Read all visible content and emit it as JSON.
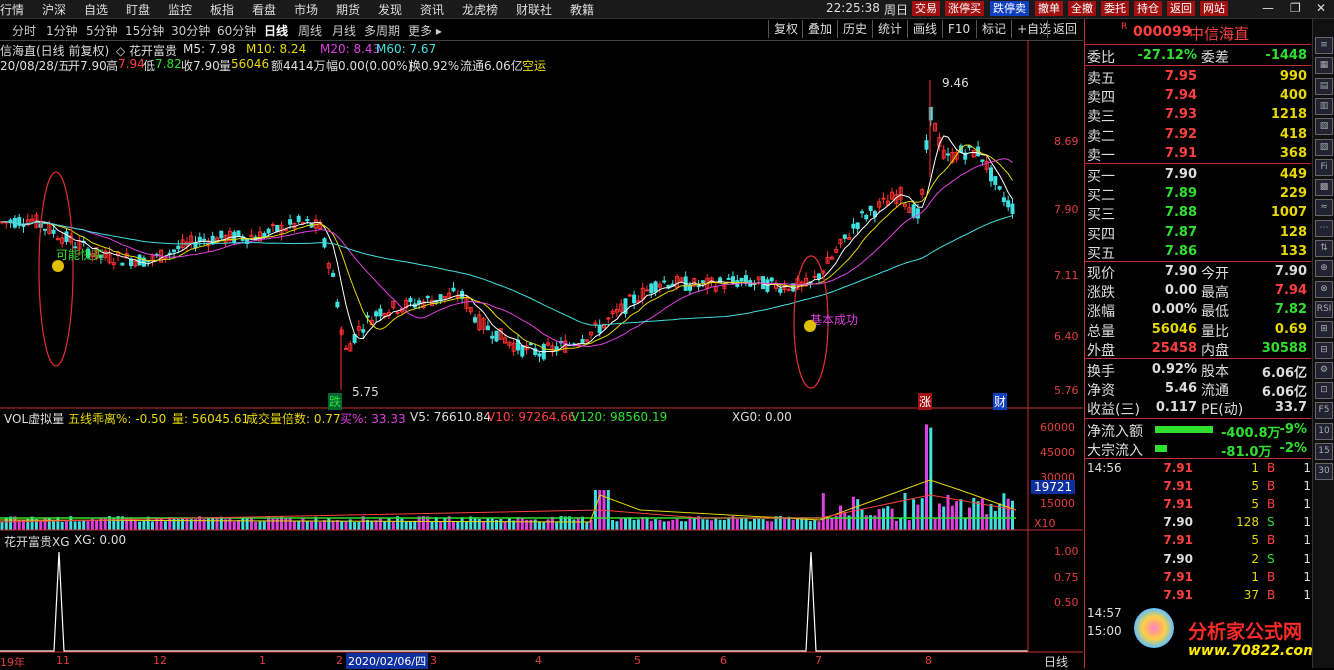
{
  "menu": [
    "行情",
    "沪深",
    "自选",
    "盯盘",
    "监控",
    "板指",
    "看盘",
    "市场",
    "期货",
    "发现",
    "资讯",
    "龙虎榜",
    "财联社",
    "教籍"
  ],
  "clock": "22:25:38",
  "weekday": "周日",
  "menu_buttons": [
    "交易",
    "涨停买",
    "跌停卖",
    "撤单",
    "全撤",
    "委托",
    "持仓",
    "返回",
    "网站"
  ],
  "periods": [
    "分时",
    "1分钟",
    "5分钟",
    "15分钟",
    "30分钟",
    "60分钟",
    "日线",
    "周线",
    "月线",
    "多周期",
    "更多 ▸"
  ],
  "selected_period": "日线",
  "tools": [
    "复权",
    "叠加",
    "历史",
    "统计",
    "画线",
    "F10",
    "标记",
    "+自选",
    "返回"
  ],
  "chart_header": {
    "name": "信海直(日线 前复权)",
    "indicator": "◇ 花开富贵",
    "m5": "M5: 7.98",
    "m10": "M10: 8.24",
    "m20": "M20: 8.43",
    "m60": "M60: 7.67",
    "date": "20/08/28/五",
    "open": "开7.90",
    "high_lbl": "高",
    "high": "7.94",
    "low_lbl": "低",
    "low": "7.82",
    "close": "收7.90",
    "vol_lbl": "量",
    "vol": "56046",
    "amount": "额4414万",
    "amp": "幅0.00(0.00%)",
    "turn": "换0.92%",
    "float": "流通6.06亿",
    "status": "空运"
  },
  "price_axis": [
    "8.69",
    "7.90",
    "7.11",
    "6.40",
    "5.76"
  ],
  "chart_annotations": {
    "high": "9.46",
    "low": "5.75",
    "buy_label": "可能快买",
    "success_label": "基本成功",
    "die": "跌",
    "zhang": "涨",
    "cai": "财"
  },
  "vol_header": {
    "title": "VOL虚拟量",
    "dev": "五线乖离%: -0.50",
    "vol": "量: 56045.61",
    "times": "成交量倍数: 0.77",
    "buy": "买%: 33.33",
    "v5": "V5: 76610.84",
    "v10": "V10: 97264.66",
    "v120": "V120: 98560.19",
    "xg0": "XG0: 0.00"
  },
  "vol_axis": [
    "60000",
    "45000",
    "30000",
    "15000"
  ],
  "vol_marker": "19721",
  "vol_unit": "X10",
  "ind_header": {
    "title": "花开富贵XG",
    "xg": "XG: 0.00"
  },
  "ind_axis": [
    "1.00",
    "0.75",
    "0.50"
  ],
  "date_axis": [
    "19年",
    "11",
    "12",
    "1",
    "2",
    "2020/02/06/四",
    "3",
    "4",
    "5",
    "6",
    "7",
    "8"
  ],
  "date_axis_right": "日线",
  "right_panel": {
    "code": "000099",
    "name": "中信海直",
    "weibi_lbl": "委比",
    "weibi": "-27.12%",
    "weicha_lbl": "委差",
    "weicha": "-1448",
    "asks": [
      {
        "label": "卖五",
        "price": "7.95",
        "vol": "990"
      },
      {
        "label": "卖四",
        "price": "7.94",
        "vol": "400"
      },
      {
        "label": "卖三",
        "price": "7.93",
        "vol": "1218"
      },
      {
        "label": "卖二",
        "price": "7.92",
        "vol": "418"
      },
      {
        "label": "卖一",
        "price": "7.91",
        "vol": "368"
      }
    ],
    "bids": [
      {
        "label": "买一",
        "price": "7.90",
        "vol": "449"
      },
      {
        "label": "买二",
        "price": "7.89",
        "vol": "229"
      },
      {
        "label": "买三",
        "price": "7.88",
        "vol": "1007"
      },
      {
        "label": "买四",
        "price": "7.87",
        "vol": "128"
      },
      {
        "label": "买五",
        "price": "7.86",
        "vol": "133"
      }
    ],
    "stats": [
      {
        "l1": "现价",
        "v1": "7.90",
        "l2": "今开",
        "v2": "7.90",
        "c1": "white",
        "c2": "white"
      },
      {
        "l1": "涨跌",
        "v1": "0.00",
        "l2": "最高",
        "v2": "7.94",
        "c1": "white",
        "c2": "red"
      },
      {
        "l1": "涨幅",
        "v1": "0.00%",
        "l2": "最低",
        "v2": "7.82",
        "c1": "white",
        "c2": "green"
      },
      {
        "l1": "总量",
        "v1": "56046",
        "l2": "量比",
        "v2": "0.69",
        "c1": "yellow",
        "c2": "yellow"
      },
      {
        "l1": "外盘",
        "v1": "25458",
        "l2": "内盘",
        "v2": "30588",
        "c1": "red",
        "c2": "green"
      }
    ],
    "stats2": [
      {
        "l1": "换手",
        "v1": "0.92%",
        "l2": "股本",
        "v2": "6.06亿"
      },
      {
        "l1": "净资",
        "v1": "5.46",
        "l2": "流通",
        "v2": "6.06亿"
      },
      {
        "l1": "收益(三)",
        "v1": "0.117",
        "l2": "PE(动)",
        "v2": "33.7"
      }
    ],
    "flow": [
      {
        "label": "净流入额",
        "val": "-400.8万",
        "pct": "-9%"
      },
      {
        "label": "大宗流入",
        "val": "-81.0万",
        "pct": "-2%"
      }
    ],
    "ticks": [
      {
        "time": "14:56",
        "price": "7.91",
        "vol": "1",
        "bs": "B",
        "n": "1",
        "c": "red"
      },
      {
        "time": "",
        "price": "7.91",
        "vol": "5",
        "bs": "B",
        "n": "1",
        "c": "red"
      },
      {
        "time": "",
        "price": "7.91",
        "vol": "5",
        "bs": "B",
        "n": "1",
        "c": "red"
      },
      {
        "time": "",
        "price": "7.90",
        "vol": "128",
        "bs": "S",
        "n": "1",
        "c": "white"
      },
      {
        "time": "",
        "price": "7.91",
        "vol": "5",
        "bs": "B",
        "n": "1",
        "c": "red"
      },
      {
        "time": "",
        "price": "7.90",
        "vol": "2",
        "bs": "S",
        "n": "1",
        "c": "white"
      },
      {
        "time": "",
        "price": "7.91",
        "vol": "1",
        "bs": "B",
        "n": "1",
        "c": "red"
      },
      {
        "time": "",
        "price": "7.91",
        "vol": "37",
        "bs": "B",
        "n": "1",
        "c": "red"
      },
      {
        "time": "14:57",
        "price": "",
        "vol": "",
        "bs": "",
        "n": "",
        "c": "white"
      },
      {
        "time": "15:00",
        "price": "",
        "vol": "",
        "bs": "",
        "n": "",
        "c": "white"
      }
    ]
  },
  "watermark": {
    "title": "分析家公式网",
    "url": "www.70822.com"
  },
  "sidebar_icons": [
    "≡",
    "▦",
    "▤",
    "▥",
    "▧",
    "▨",
    "Fi",
    "▩",
    "≈",
    "⋯",
    "⇅",
    "⊕",
    "⊗",
    "RSI",
    "⊞",
    "⊟",
    "⚙",
    "⊡",
    "F5",
    "10",
    "15",
    "30"
  ]
}
